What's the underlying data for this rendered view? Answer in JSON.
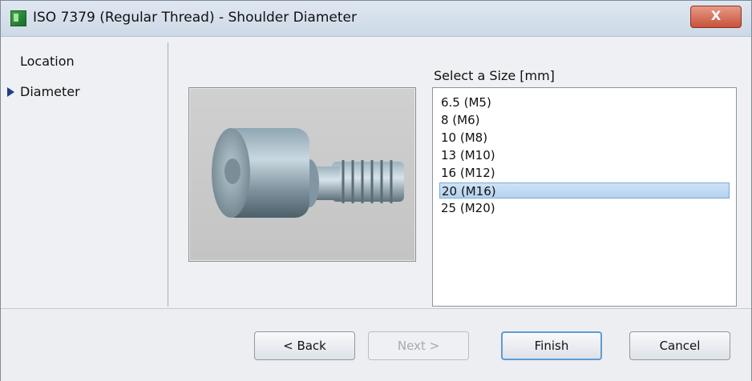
{
  "window": {
    "title": "ISO 7379 (Regular Thread) - Shoulder Diameter",
    "close_label": "X"
  },
  "nav": {
    "items": [
      {
        "label": "Location",
        "current": false
      },
      {
        "label": "Diameter",
        "current": true
      }
    ]
  },
  "preview": {
    "image_name": "shoulder-screw-preview"
  },
  "size_selector": {
    "label": "Select a Size [mm]",
    "options": [
      "6.5 (M5)",
      "8 (M6)",
      "10 (M8)",
      "13 (M10)",
      "16 (M12)",
      "20 (M16)",
      "25 (M20)"
    ],
    "selected": "20 (M16)"
  },
  "buttons": {
    "back": "< Back",
    "next": "Next >",
    "finish": "Finish",
    "cancel": "Cancel"
  },
  "colors": {
    "accent": "#5e9bd6",
    "selection": "#b3d2ef",
    "close": "#c8523a"
  }
}
